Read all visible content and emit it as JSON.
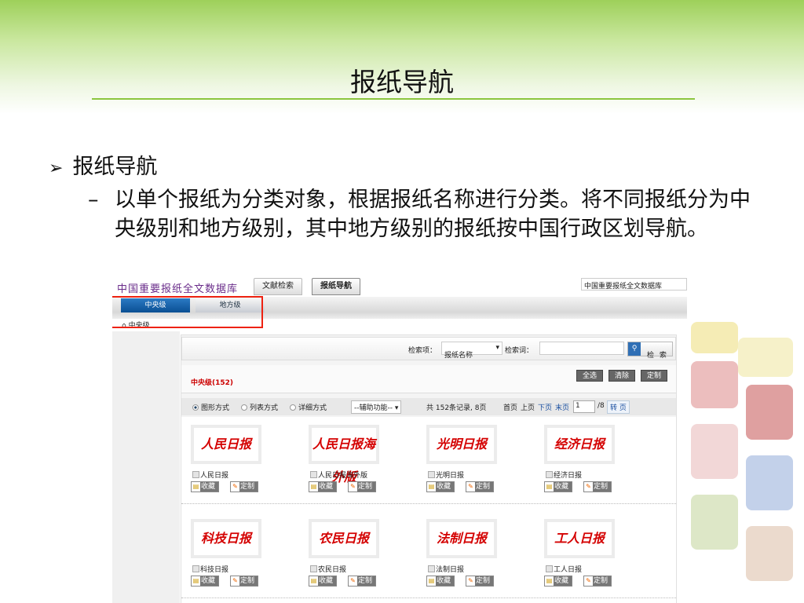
{
  "slide": {
    "title": "报纸导航",
    "bullet": "报纸导航",
    "dash": "–",
    "sub": "以单个报纸为分类对象，根据报纸名称进行分类。将不同报纸分为中央级别和地方级别，其中地方级别的报纸按中国行政区划导航。"
  },
  "app": {
    "logo": "中国重要报纸全文数据库",
    "tabs": [
      "文献检索",
      "报纸导航"
    ],
    "db_select": "中国重要报纸全文数据库",
    "nav_tabs": [
      "中央级",
      "地方级"
    ],
    "breadcrumb": "中央级",
    "search": {
      "field_label": "检索项：",
      "field_value": "报纸名称",
      "term_label": "检索词：",
      "term_value": "",
      "button": "检 索"
    },
    "section": {
      "title": "中央级(152)",
      "buttons": [
        "全选",
        "清除",
        "定制"
      ]
    },
    "toolbar": {
      "views": [
        "图形方式",
        "列表方式",
        "详细方式"
      ],
      "selected_view": "图形方式",
      "aux": "--辅助功能--",
      "records": "共 152条记录, 8页",
      "first": "首页",
      "prev": "上页",
      "next": "下页",
      "last": "末页",
      "page": "1",
      "total": "/8",
      "go": "转 页"
    },
    "papers": [
      {
        "name": "人民日报"
      },
      {
        "name": "人民日报海外版"
      },
      {
        "name": "光明日报"
      },
      {
        "name": "经济日报"
      },
      {
        "name": "科技日报"
      },
      {
        "name": "农民日报"
      },
      {
        "name": "法制日报"
      },
      {
        "name": "工人日报"
      }
    ],
    "fav": "收藏",
    "custom": "定制"
  }
}
